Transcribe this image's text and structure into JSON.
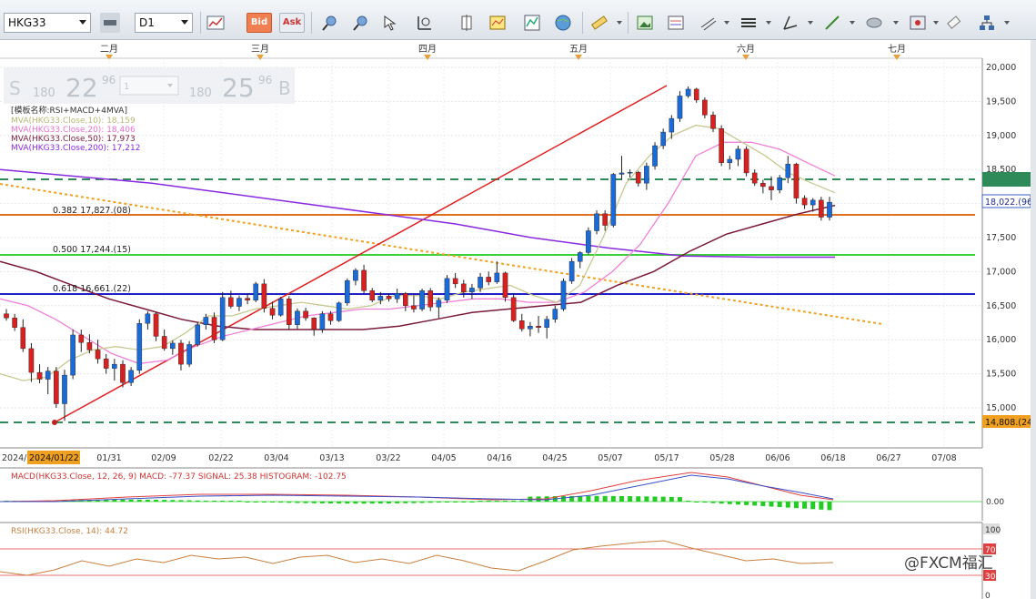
{
  "toolbar": {
    "symbol": "HKG33",
    "timeframe": "D1",
    "bid_label": "Bid",
    "ask_label": "Ask",
    "icons": [
      "line-chart-icon",
      "candle-icon",
      "magnify-icon",
      "zoom-out-icon",
      "crosshair-icon",
      "cursor-icon",
      "properties-icon",
      "globe-icon",
      "ruler-icon",
      "picture-icon",
      "template-icon",
      "indicator-icon",
      "lines-icon",
      "trendline-icon",
      "draw-line-icon",
      "ellipse-icon",
      "expert-icon",
      "eraser-icon",
      "tree-icon"
    ]
  },
  "months": [
    {
      "label": "二月"
    },
    {
      "label": "三月"
    },
    {
      "label": "四月"
    },
    {
      "label": "五月"
    },
    {
      "label": "六月"
    },
    {
      "label": "七月"
    }
  ],
  "trade_panel": {
    "sell_letter": "S",
    "sell_small": "180",
    "sell_big": "22",
    "sell_sup": "96",
    "lot": "1",
    "buy_small": "180",
    "buy_big": "25",
    "buy_sup": "96",
    "buy_letter": "B"
  },
  "legend": {
    "template": "[模板名称:RSI+MACD+4MVA]",
    "mva10": "MVA(HKG33.Close,10): 18,159",
    "mva20": "MVA(HKG33.Close,20): 18,406",
    "mva50": "MVA(HKG33.Close,50): 17,973",
    "mva200": "MVA(HKG33.Close,200): 17,212"
  },
  "fib": {
    "f382": "0.382 17,827.(08)",
    "f500": "0.500 17,244.(15)",
    "f618": "0.618 16,661.(22)"
  },
  "price_labels": {
    "ticks": [
      "20,000",
      "19,500",
      "19,000",
      "18,500",
      "18,000",
      "17,500",
      "17,000",
      "16,500",
      "16,000",
      "15,500",
      "15,000"
    ],
    "current": "18,022.(96",
    "low": "14,808.(24"
  },
  "date_axis": {
    "start": "2024/",
    "highlight": "2024/01/22",
    "dates": [
      "01/31",
      "02/09",
      "02/22",
      "03/04",
      "03/13",
      "03/22",
      "04/05",
      "04/16",
      "04/25",
      "05/07",
      "05/17",
      "05/28",
      "06/06",
      "06/18",
      "06/27",
      "07/08"
    ]
  },
  "macd": {
    "legend": "MACD(HKG33.Close, 12, 26, 9)  MACD: -77.37  SIGNAL: 25.38  HISTOGRAM: -102.75",
    "tick": "0.00"
  },
  "rsi": {
    "legend": "RSI(HKG33.Close, 14): 44.72",
    "ticks": [
      "100",
      "70",
      "30",
      "0"
    ]
  },
  "watermark": "@FXCM福汇",
  "chart_data": {
    "type": "candlestick",
    "ylim": [
      14700,
      20100
    ],
    "candles": [
      [
        16380,
        16450,
        16280,
        16320
      ],
      [
        16320,
        16380,
        16130,
        16180
      ],
      [
        16180,
        16300,
        15820,
        15870
      ],
      [
        15870,
        15950,
        15380,
        15520
      ],
      [
        15520,
        15640,
        15360,
        15420
      ],
      [
        15420,
        15600,
        15200,
        15540
      ],
      [
        15540,
        15600,
        15000,
        15060
      ],
      [
        15060,
        15560,
        14808,
        15480
      ],
      [
        15480,
        16150,
        15420,
        16070
      ],
      [
        16070,
        16150,
        15820,
        15960
      ],
      [
        15960,
        16080,
        15800,
        15850
      ],
      [
        15850,
        16000,
        15650,
        15720
      ],
      [
        15720,
        15790,
        15500,
        15580
      ],
      [
        15580,
        15720,
        15400,
        15640
      ],
      [
        15640,
        15700,
        15300,
        15370
      ],
      [
        15370,
        15600,
        15320,
        15550
      ],
      [
        15550,
        16300,
        15500,
        16240
      ],
      [
        16240,
        16420,
        16150,
        16380
      ],
      [
        16380,
        16400,
        15980,
        16050
      ],
      [
        16050,
        16150,
        15840,
        15870
      ],
      [
        15870,
        15990,
        15780,
        15950
      ],
      [
        15950,
        16000,
        15550,
        15640
      ],
      [
        15640,
        15980,
        15600,
        15930
      ],
      [
        15930,
        16250,
        15900,
        16220
      ],
      [
        16220,
        16380,
        16150,
        16330
      ],
      [
        16330,
        16400,
        15950,
        16000
      ],
      [
        16000,
        16700,
        15980,
        16620
      ],
      [
        16620,
        16720,
        16460,
        16490
      ],
      [
        16490,
        16650,
        16420,
        16610
      ],
      [
        16610,
        16680,
        16520,
        16580
      ],
      [
        16580,
        16850,
        16550,
        16820
      ],
      [
        16820,
        16890,
        16400,
        16460
      ],
      [
        16460,
        16560,
        16300,
        16360
      ],
      [
        16360,
        16630,
        16340,
        16600
      ],
      [
        16600,
        16640,
        16150,
        16220
      ],
      [
        16220,
        16460,
        16160,
        16420
      ],
      [
        16420,
        16470,
        16280,
        16320
      ],
      [
        16320,
        16330,
        16060,
        16150
      ],
      [
        16150,
        16420,
        16100,
        16380
      ],
      [
        16380,
        16420,
        16220,
        16280
      ],
      [
        16280,
        16560,
        16260,
        16540
      ],
      [
        16540,
        16900,
        16500,
        16870
      ],
      [
        16870,
        17050,
        16800,
        17020
      ],
      [
        17020,
        17100,
        16680,
        16720
      ],
      [
        16720,
        16760,
        16550,
        16580
      ],
      [
        16580,
        16700,
        16520,
        16640
      ],
      [
        16640,
        16680,
        16560,
        16600
      ],
      [
        16600,
        16750,
        16540,
        16680
      ],
      [
        16680,
        16700,
        16420,
        16500
      ],
      [
        16500,
        16650,
        16400,
        16450
      ],
      [
        16450,
        16750,
        16420,
        16720
      ],
      [
        16720,
        16760,
        16420,
        16480
      ],
      [
        16480,
        16620,
        16320,
        16580
      ],
      [
        16580,
        16950,
        16540,
        16900
      ],
      [
        16900,
        16980,
        16760,
        16820
      ],
      [
        16820,
        16880,
        16620,
        16700
      ],
      [
        16700,
        16820,
        16600,
        16760
      ],
      [
        16760,
        16980,
        16700,
        16920
      ],
      [
        16920,
        17000,
        16800,
        16850
      ],
      [
        16850,
        17150,
        16820,
        16980
      ],
      [
        16980,
        17000,
        16560,
        16620
      ],
      [
        16620,
        16680,
        16260,
        16280
      ],
      [
        16280,
        16380,
        16120,
        16160
      ],
      [
        16160,
        16260,
        16050,
        16200
      ],
      [
        16200,
        16350,
        16100,
        16180
      ],
      [
        16180,
        16350,
        16020,
        16300
      ],
      [
        16300,
        16500,
        16250,
        16450
      ],
      [
        16450,
        16900,
        16420,
        16860
      ],
      [
        16860,
        17200,
        16820,
        17150
      ],
      [
        17150,
        17300,
        17050,
        17280
      ],
      [
        17280,
        17650,
        17250,
        17600
      ],
      [
        17600,
        17900,
        17550,
        17850
      ],
      [
        17850,
        17900,
        17600,
        17680
      ],
      [
        17680,
        18450,
        17650,
        18430
      ],
      [
        18430,
        18700,
        18350,
        18450
      ],
      [
        18450,
        18500,
        18380,
        18460
      ],
      [
        18460,
        18480,
        18250,
        18300
      ],
      [
        18300,
        18600,
        18200,
        18550
      ],
      [
        18550,
        18900,
        18500,
        18850
      ],
      [
        18850,
        19100,
        18800,
        19050
      ],
      [
        19050,
        19300,
        18950,
        19250
      ],
      [
        19250,
        19650,
        19200,
        19580
      ],
      [
        19580,
        19720,
        19550,
        19680
      ],
      [
        19680,
        19700,
        19480,
        19520
      ],
      [
        19520,
        19560,
        19250,
        19300
      ],
      [
        19300,
        19350,
        19050,
        19100
      ],
      [
        19100,
        19150,
        18550,
        18600
      ],
      [
        18600,
        18700,
        18500,
        18650
      ],
      [
        18650,
        18850,
        18550,
        18800
      ],
      [
        18800,
        18840,
        18400,
        18450
      ],
      [
        18450,
        18500,
        18260,
        18300
      ],
      [
        18300,
        18350,
        18150,
        18250
      ],
      [
        18250,
        18400,
        18050,
        18200
      ],
      [
        18200,
        18420,
        18150,
        18380
      ],
      [
        18380,
        18700,
        18300,
        18580
      ],
      [
        18580,
        18600,
        18000,
        18080
      ],
      [
        18080,
        18120,
        17920,
        17980
      ],
      [
        17980,
        18080,
        17880,
        18050
      ],
      [
        18050,
        18100,
        17750,
        17800
      ],
      [
        17800,
        18100,
        17750,
        18020
      ]
    ],
    "mva10": [
      15500,
      15400,
      15450,
      15700,
      15850,
      15900,
      15850,
      15900,
      16100,
      16350,
      16350,
      16450,
      16500,
      16550,
      16500,
      16450,
      16500,
      16650,
      16650,
      16600,
      16700,
      16750,
      16800,
      16650,
      16550,
      16800,
      17500,
      18300,
      18700,
      19000,
      19150,
      19100,
      18900,
      18700,
      18450,
      18300,
      18159
    ],
    "mva20": [
      16600,
      16500,
      16300,
      16050,
      15800,
      15650,
      15700,
      15900,
      16050,
      16150,
      16250,
      16350,
      16400,
      16450,
      16450,
      16500,
      16550,
      16600,
      16600,
      16550,
      16550,
      16700,
      17000,
      17400,
      18000,
      18700,
      18900,
      18900,
      18800,
      18600,
      18406
    ],
    "mva50": [
      17150,
      17000,
      16800,
      16600,
      16450,
      16300,
      16200,
      16150,
      16150,
      16150,
      16150,
      16200,
      16300,
      16400,
      16450,
      16500,
      16550,
      16800,
      17000,
      17300,
      17550,
      17700,
      17850,
      17973
    ],
    "mva200": [
      18500,
      18400,
      18300,
      18150,
      18000,
      17850,
      17700,
      17500,
      17350,
      17230,
      17212,
      17212
    ]
  }
}
